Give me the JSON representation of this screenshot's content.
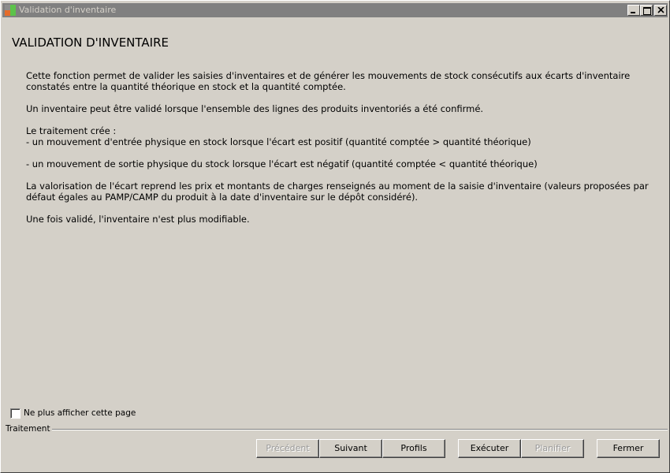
{
  "window": {
    "title": "Validation d'inventaire"
  },
  "page": {
    "title": "VALIDATION D'INVENTAIRE",
    "paragraphs": [
      "Cette fonction permet de valider les saisies d'inventaires et de générer les mouvements de stock consécutifs aux écarts d'inventaire constatés entre la quantité théorique en stock et la quantité comptée.",
      "Un inventaire peut être validé lorsque l'ensemble des lignes des produits inventoriés a été confirmé.",
      "Le traitement crée :",
      "- un mouvement d'entrée physique en stock lorsque l'écart est positif (quantité comptée > quantité théorique)",
      "- un mouvement de sortie physique du stock lorsque l'écart est négatif (quantité comptée < quantité théorique)",
      "La valorisation de l'écart reprend les prix et montants de charges renseignés au moment de la saisie d'inventaire (valeurs proposées par défaut égales au PAMP/CAMP du produit à la date d'inventaire sur le dépôt considéré).",
      "Une fois validé, l'inventaire n'est plus modifiable."
    ]
  },
  "checkbox": {
    "label": "Ne plus afficher cette page",
    "checked": false
  },
  "section": {
    "label": "Traitement"
  },
  "buttons": {
    "previous": "Précédent",
    "next": "Suivant",
    "profiles": "Profils",
    "execute": "Exécuter",
    "schedule": "Planifier",
    "close": "Fermer"
  },
  "icons": {
    "app": "app-icon",
    "minimize": "minimize-icon",
    "maximize": "maximize-icon",
    "close": "close-icon"
  },
  "colors": {
    "window_bg": "#d4d0c8",
    "titlebar_inactive": "#808080",
    "disabled_text": "#9a9a9a"
  }
}
